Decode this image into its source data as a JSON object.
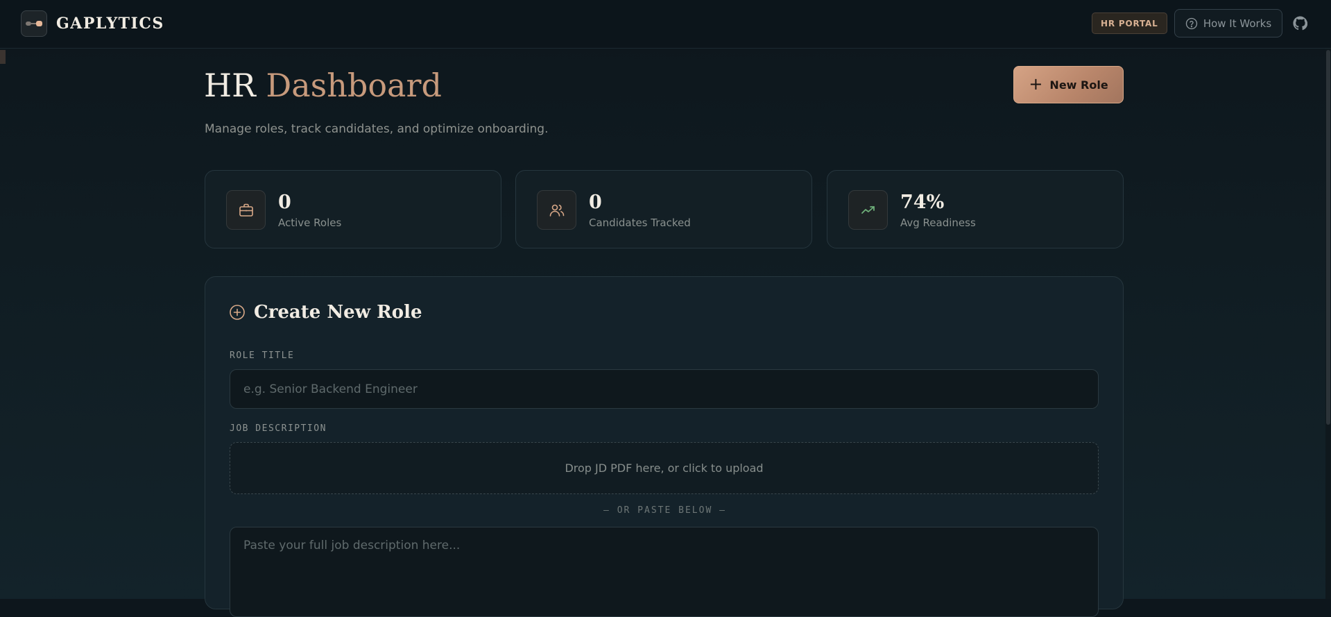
{
  "header": {
    "brand": "GAPLYTICS",
    "portal_badge": "HR PORTAL",
    "how_it_works": "How It Works"
  },
  "page": {
    "title_part1": "HR",
    "title_part2": "Dashboard",
    "subtitle": "Manage roles, track candidates, and optimize onboarding.",
    "new_role_label": "New Role"
  },
  "stats": [
    {
      "value": "0",
      "label": "Active Roles",
      "icon": "briefcase-icon"
    },
    {
      "value": "0",
      "label": "Candidates Tracked",
      "icon": "users-icon"
    },
    {
      "value": "74%",
      "label": "Avg Readiness",
      "icon": "trending-up-icon"
    }
  ],
  "create_role": {
    "title": "Create New Role",
    "role_title_label": "ROLE TITLE",
    "role_title_placeholder": "e.g. Senior Backend Engineer",
    "jd_label": "JOB DESCRIPTION",
    "dropzone_text": "Drop JD PDF here, or click to upload",
    "or_paste": "— OR PASTE BELOW —",
    "jd_placeholder": "Paste your full job description here..."
  },
  "colors": {
    "accent": "#c79a7c",
    "background": "#0d161c",
    "card": "#14222a",
    "success": "#6fb07a"
  }
}
